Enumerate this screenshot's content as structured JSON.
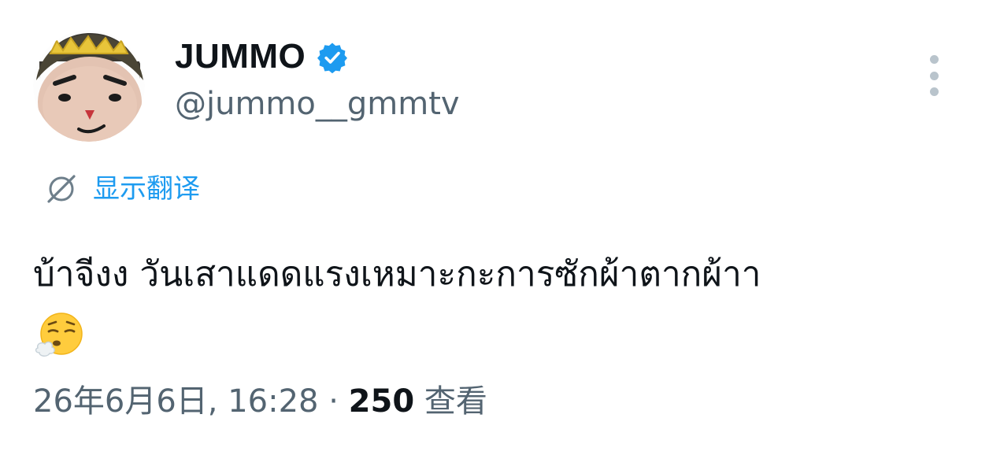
{
  "author": {
    "display_name": "JUMMO",
    "handle": "@jummo__gmmtv",
    "verified": true,
    "avatar_icon": "mascot-face-avatar"
  },
  "translate": {
    "label": "显示翻译",
    "icon": "globe-slash-icon"
  },
  "tweet": {
    "text": "บ้าจีงง วันเสาแดดแรงเหมาะกะการซักผ้าตากผ้าา",
    "emoji": "😮‍💨",
    "emoji_icon": "face-exhaling-emoji"
  },
  "meta": {
    "timestamp": "26年6月6日, 16:28",
    "separator": "·",
    "views_count": "250",
    "views_label": "查看"
  },
  "colors": {
    "text_primary": "#0f1419",
    "text_secondary": "#536471",
    "accent": "#1d9bf0",
    "verified": "#1d9bf0",
    "more_dots": "#b9c4cc"
  }
}
